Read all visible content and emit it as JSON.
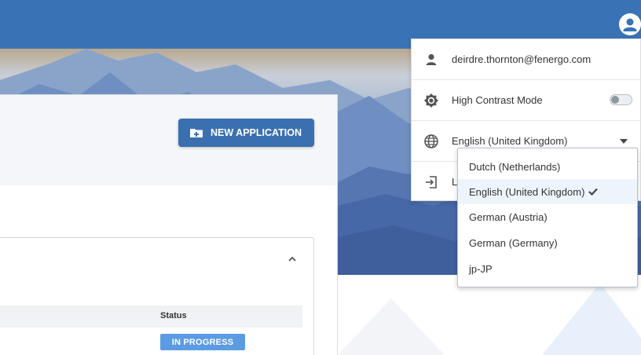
{
  "header": {
    "avatar_icon": "account-circle-icon",
    "brand_color": "#3a73b5"
  },
  "main": {
    "new_application_label": "NEW APPLICATION",
    "new_application_icon": "folder-plus-icon",
    "collapse_icon": "chevron-up-icon",
    "table": {
      "columns": [
        "Status"
      ],
      "rows": [
        {
          "status": "IN PROGRESS"
        }
      ]
    },
    "status_color": "#5b9be3"
  },
  "user_menu": {
    "email": "deirdre.thornton@fenergo.com",
    "email_icon": "person-icon",
    "high_contrast_label": "High Contrast Mode",
    "high_contrast_icon": "contrast-icon",
    "high_contrast_on": false,
    "language_label": "English (United Kingdom)",
    "language_icon": "globe-icon",
    "logout_label": "L",
    "logout_icon": "logout-icon"
  },
  "language_options": {
    "items": [
      {
        "label": "Dutch (Netherlands)",
        "selected": false
      },
      {
        "label": "English (United Kingdom)",
        "selected": true
      },
      {
        "label": "German (Austria)",
        "selected": false
      },
      {
        "label": "German (Germany)",
        "selected": false
      },
      {
        "label": "jp-JP",
        "selected": false
      }
    ],
    "selected_icon": "checkmark-icon"
  }
}
